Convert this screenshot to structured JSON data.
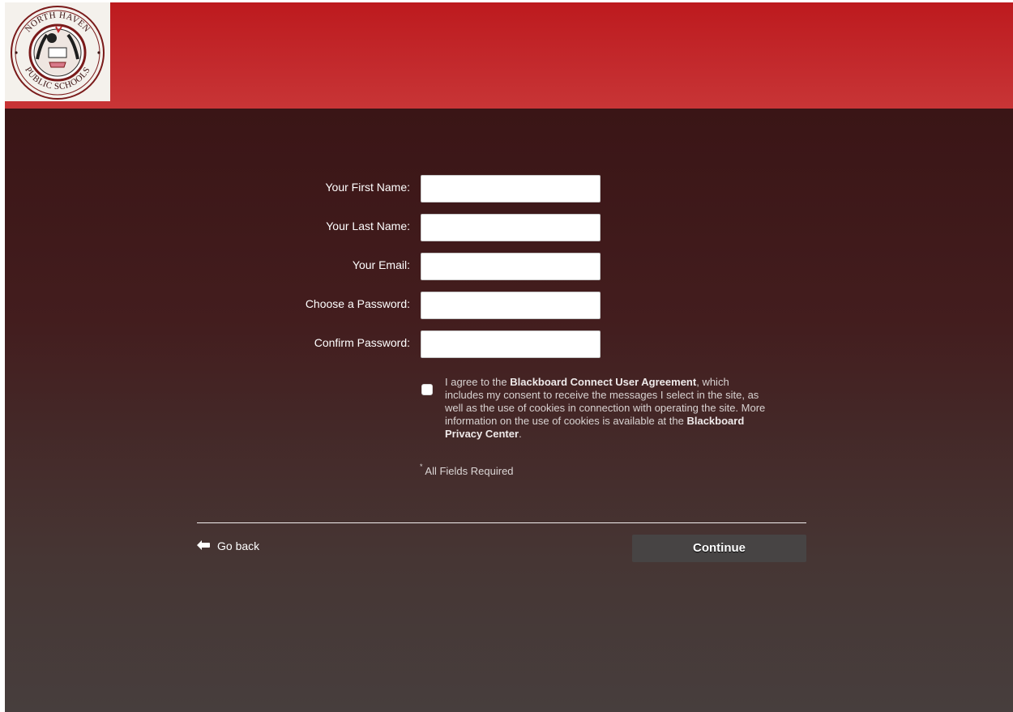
{
  "colors": {
    "header_red": "#bd1a1e",
    "background_dark": "#3a1516",
    "background_bottom": "#473e3d",
    "button_bg": "#474444"
  },
  "header": {
    "logo": {
      "top_text": "NORTH HAVEN",
      "bottom_text": "PUBLIC SCHOOLS",
      "icon": "school-seal-icon"
    }
  },
  "form": {
    "fields": [
      {
        "label": "Your First Name:",
        "value": "",
        "type": "text"
      },
      {
        "label": "Your Last Name:",
        "value": "",
        "type": "text"
      },
      {
        "label": "Your Email:",
        "value": "",
        "type": "email"
      },
      {
        "label": "Choose a Password:",
        "value": "",
        "type": "password"
      },
      {
        "label": "Confirm Password:",
        "value": "",
        "type": "password"
      }
    ],
    "agreement": {
      "checked": false,
      "text_before": "I agree to the ",
      "link1": "Blackboard Connect User Agreement",
      "text_middle": ", which includes my consent to receive the messages I select in the site, as well as the use of cookies in connection with operating the site. More information on the use of cookies is available at the ",
      "link2": "Blackboard Privacy Center",
      "text_after": "."
    },
    "required_star": "*",
    "required_note": "All Fields Required"
  },
  "footer": {
    "go_back_icon": "arrow-left-icon",
    "go_back_label": "Go back",
    "continue_label": "Continue"
  }
}
